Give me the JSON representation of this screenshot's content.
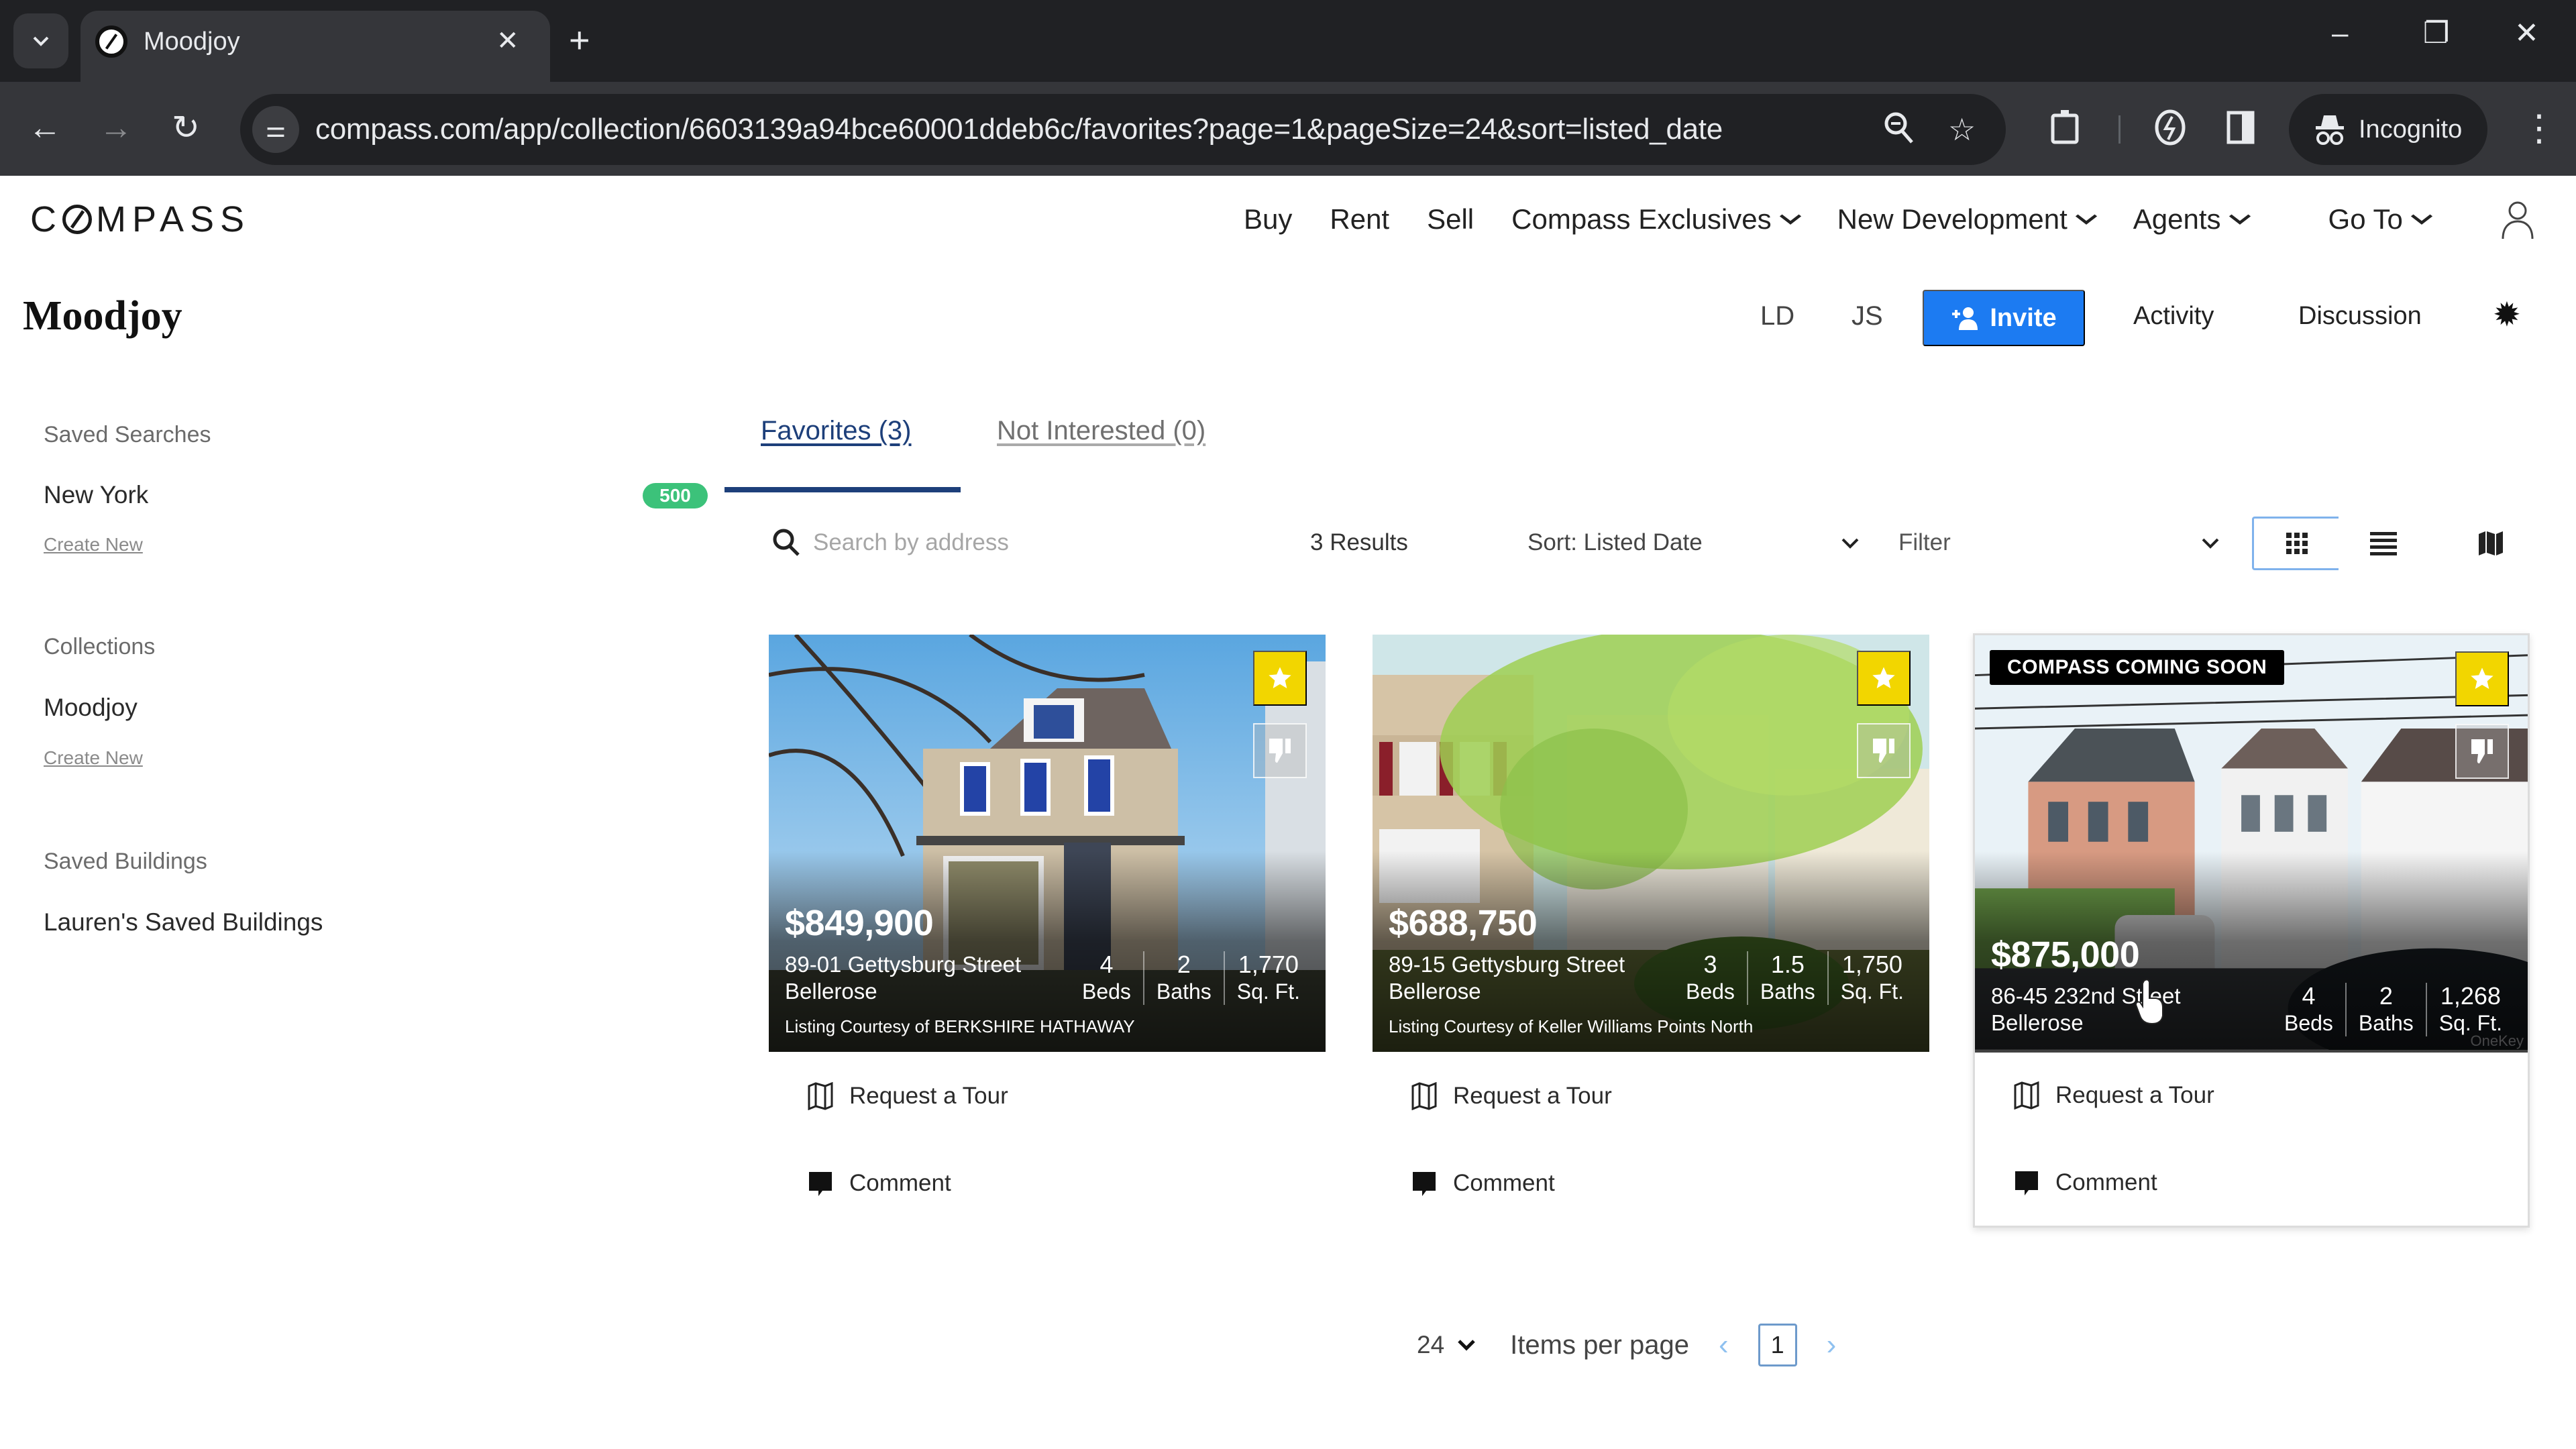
{
  "browser": {
    "tab_title": "Moodjoy",
    "url": "compass.com/app/collection/6603139a94bce60001ddeb6c/favorites?page=1&pageSize=24&sort=listed_date",
    "profile_label": "Incognito",
    "icons": {
      "tab_list": "chevron-down-icon",
      "close_tab": "close-icon",
      "new_tab": "plus-icon",
      "back": "arrow-left-icon",
      "forward": "arrow-right-icon",
      "reload": "reload-icon",
      "site_info": "tune-icon",
      "zoom": "zoom-icon",
      "bookmark": "star-outline-icon",
      "extensions": "puzzle-icon",
      "performance": "leaf-bolt-icon",
      "side_panel": "side-panel-icon",
      "incognito": "incognito-icon",
      "menu": "kebab-icon"
    },
    "window": {
      "minimize": "–",
      "restore": "❐",
      "close": "✕"
    }
  },
  "site_header": {
    "logo": "COMPASS",
    "nav": [
      {
        "label": "Buy",
        "has_dropdown": false
      },
      {
        "label": "Rent",
        "has_dropdown": false
      },
      {
        "label": "Sell",
        "has_dropdown": false
      },
      {
        "label": "Compass Exclusives",
        "has_dropdown": true
      },
      {
        "label": "New Development",
        "has_dropdown": true
      },
      {
        "label": "Agents",
        "has_dropdown": true
      },
      {
        "label": "Go To",
        "has_dropdown": true
      }
    ],
    "account_icon": "user-icon"
  },
  "collection_header": {
    "title": "Moodjoy",
    "collaborators": [
      "LD",
      "JS"
    ],
    "invite_label": "Invite",
    "activity_label": "Activity",
    "discussion_label": "Discussion",
    "settings_icon": "gear-icon",
    "accent_color": "#1c7bf2"
  },
  "sidebar": {
    "saved_searches": {
      "heading": "Saved Searches",
      "items": [
        {
          "label": "New York",
          "count": "500"
        }
      ],
      "create_label": "Create New"
    },
    "collections": {
      "heading": "Collections",
      "items": [
        {
          "label": "Moodjoy"
        }
      ],
      "create_label": "Create New"
    },
    "saved_buildings": {
      "heading": "Saved Buildings",
      "items": [
        {
          "label": "Lauren's Saved Buildings"
        }
      ]
    },
    "badge_color": "#3cc27a"
  },
  "tabs": [
    {
      "label": "Favorites (3)",
      "active": true
    },
    {
      "label": "Not Interested (0)",
      "active": false
    }
  ],
  "toolbar": {
    "search_placeholder": "Search by address",
    "search_value": "",
    "results": "3 Results",
    "sort_label": "Sort: Listed Date",
    "filter_label": "Filter",
    "views": [
      {
        "name": "grid",
        "icon": "grid-icon",
        "active": true
      },
      {
        "name": "list",
        "icon": "list-icon",
        "active": false
      },
      {
        "name": "map",
        "icon": "map-icon",
        "active": false
      }
    ]
  },
  "listings": [
    {
      "price": "$849,900",
      "street": "89-01 Gettysburg Street",
      "neighborhood": "Bellerose",
      "beds": "4",
      "beds_label": "Beds",
      "baths": "2",
      "baths_label": "Baths",
      "sqft": "1,770",
      "sqft_label": "Sq. Ft.",
      "courtesy": "Listing Courtesy of BERKSHIRE HATHAWAY",
      "badge": "",
      "favorited": true,
      "actions": {
        "tour": "Request a Tour",
        "comment": "Comment"
      }
    },
    {
      "price": "$688,750",
      "street": "89-15 Gettysburg Street",
      "neighborhood": "Bellerose",
      "beds": "3",
      "beds_label": "Beds",
      "baths": "1.5",
      "baths_label": "Baths",
      "sqft": "1,750",
      "sqft_label": "Sq. Ft.",
      "courtesy": "Listing Courtesy of Keller Williams Points North",
      "badge": "",
      "favorited": true,
      "actions": {
        "tour": "Request a Tour",
        "comment": "Comment"
      }
    },
    {
      "price": "$875,000",
      "street": "86-45 232nd Street",
      "neighborhood": "Bellerose",
      "beds": "4",
      "beds_label": "Beds",
      "baths": "2",
      "baths_label": "Baths",
      "sqft": "1,268",
      "sqft_label": "Sq. Ft.",
      "courtesy": "",
      "badge": "COMPASS COMING SOON",
      "watermark": "OneKey",
      "favorited": true,
      "actions": {
        "tour": "Request a Tour",
        "comment": "Comment"
      }
    }
  ],
  "pagination": {
    "page_size": "24",
    "page_size_label": "Items per page",
    "current_page": "1"
  },
  "colors": {
    "favorite_yellow": "#f2d600",
    "tab_active": "#1d3f7a",
    "pager_arrow": "#8fc1f0"
  }
}
